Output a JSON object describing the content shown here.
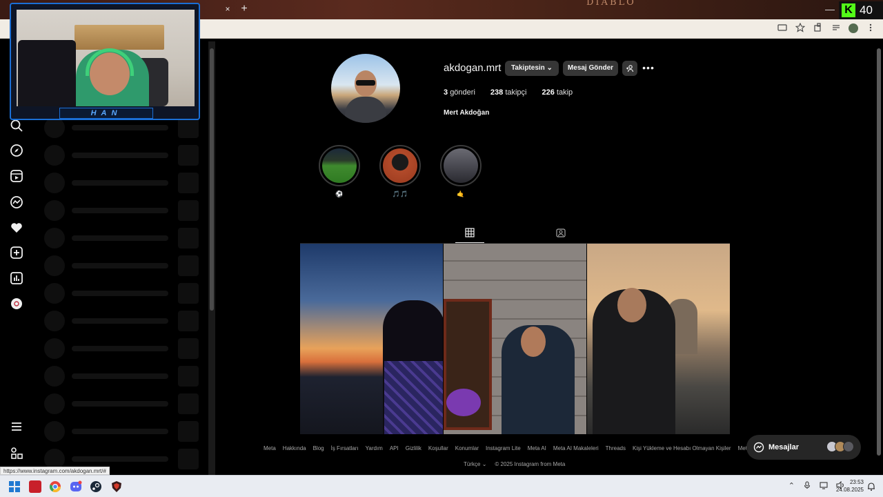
{
  "browser": {
    "tab_close": "×",
    "tab_new": "+",
    "background_game_title": "DIABLO",
    "minimize_glyph": "—",
    "kick_logo": "K",
    "kick_viewer_count": "40"
  },
  "webcam": {
    "label": "HAN"
  },
  "nav": {
    "icons": [
      "search-icon",
      "explore-icon",
      "reels-icon",
      "messenger-icon",
      "notifications-heart-icon",
      "create-plus-icon",
      "dashboard-icon",
      "threads-icon",
      "more-menu-icon",
      "meta-apps-icon"
    ]
  },
  "profile": {
    "username": "akdogan.mrt",
    "follow_button": "Takiptesin",
    "follow_chevron": "⌄",
    "message_button": "Mesaj Gönder",
    "more_glyph": "•••",
    "posts_count": "3",
    "posts_label": "gönderi",
    "followers_count": "238",
    "followers_label": "takipçi",
    "following_count": "226",
    "following_label": "takip",
    "full_name": "Mert Akdoğan"
  },
  "highlights": [
    {
      "label": "⚽"
    },
    {
      "label": "🎵🎵"
    },
    {
      "label": "🤙"
    }
  ],
  "footer": {
    "links": [
      "Meta",
      "Hakkında",
      "Blog",
      "İş Fırsatları",
      "Yardım",
      "API",
      "Gizlilik",
      "Koşullar",
      "Konumlar",
      "Instagram Lite",
      "Meta AI",
      "Meta AI Makaleleri",
      "Threads",
      "Kişi Yükleme ve Hesabı Olmayan Kişiler",
      "Meta"
    ],
    "language": "Türkçe",
    "language_chevron": "⌄",
    "copyright": "© 2025 Instagram from Meta"
  },
  "messages_pill": {
    "label": "Mesajlar"
  },
  "status_bar": {
    "url": "https://www.instagram.com/akdogan.mrt/#"
  },
  "taskbar": {
    "time": "23:53",
    "date": "24.08.2025",
    "tray_chevron": "⌃"
  },
  "colors": {
    "background": "#000000",
    "button": "#363636",
    "kick_green": "#53fc18",
    "webcam_border": "#1b6fd6"
  }
}
